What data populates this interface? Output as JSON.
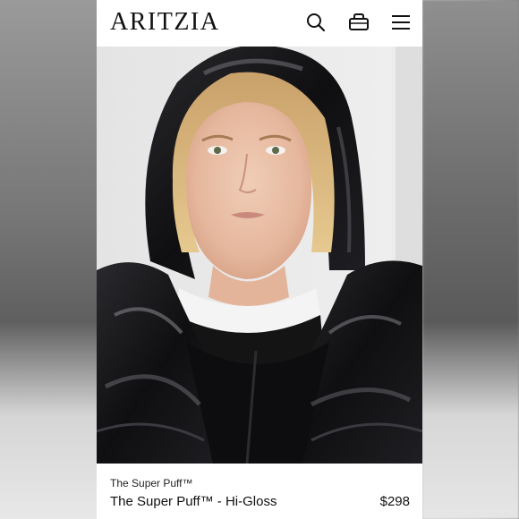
{
  "header": {
    "logo": "ARITZIA",
    "icons": [
      "search-icon",
      "bag-icon",
      "menu-icon"
    ]
  },
  "product": {
    "brand": "The Super Puff™",
    "name": "The Super Puff™ - Hi-Gloss",
    "price": "$298"
  },
  "colors": {
    "background": "#ffffff",
    "text": "#111111",
    "jacket": "#151517"
  }
}
